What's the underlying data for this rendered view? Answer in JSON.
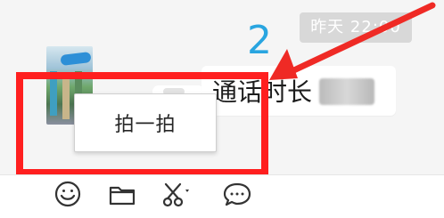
{
  "chat": {
    "timestamp": "昨天 22:00",
    "annotation_number": "2",
    "message_text": "通话时长",
    "context_menu_item": "拍一拍"
  },
  "toolbar": {
    "icons": [
      "emoji-icon",
      "folder-icon",
      "scissors-icon",
      "chat-bubble-icon"
    ]
  },
  "colors": {
    "highlight": "#ff1f1f",
    "annotation_number": "#29a5e0"
  }
}
